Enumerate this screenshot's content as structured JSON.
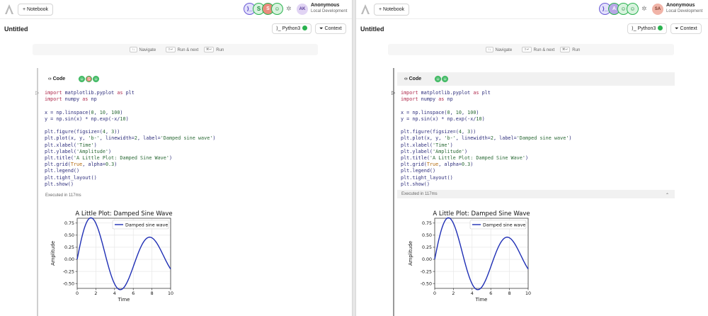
{
  "header": {
    "new_notebook_label": "+ Notebook",
    "user_name": "Anonymous",
    "user_sub": "Local Development"
  },
  "panes": [
    {
      "user_initials": "AK",
      "presence": [
        {
          "icon": "terminal-icon",
          "glyph": "⟩_"
        },
        {
          "icon": "avatar",
          "glyph": "S"
        },
        {
          "icon": "avatar",
          "glyph": "S"
        },
        {
          "icon": "bot-icon",
          "glyph": "☺"
        }
      ],
      "cell_avatars": [
        "☺",
        "S",
        "☺"
      ]
    },
    {
      "user_initials": "SA",
      "presence": [
        {
          "icon": "terminal-icon",
          "glyph": "⟩_"
        },
        {
          "icon": "avatar",
          "glyph": "A"
        },
        {
          "icon": "bot-icon",
          "glyph": "☺"
        },
        {
          "icon": "bot-icon",
          "glyph": "☺"
        }
      ],
      "cell_avatars": [
        "☺",
        "☺"
      ]
    }
  ],
  "notebook": {
    "title": "Untitled",
    "kernel_label": "Python3",
    "context_label": "Context"
  },
  "hints": {
    "navigate": {
      "key": "↑↓",
      "label": "Navigate"
    },
    "run_next": {
      "key": "⇧↵",
      "label": "Run & next"
    },
    "run": {
      "key": "⌘↵",
      "label": "Run"
    }
  },
  "cell": {
    "type_label": "Code",
    "executed_text": "Executed in 117ms"
  },
  "colors": {
    "presence_green": "#2ab24f",
    "line_color": "#1f2fb5"
  },
  "chart_data": {
    "type": "line",
    "title": "A Little Plot: Damped Sine Wave",
    "xlabel": "Time",
    "ylabel": "Amplitude",
    "xlim": [
      0,
      10
    ],
    "ylim": [
      -0.6,
      0.85
    ],
    "xticks": [
      "0",
      "2",
      "4",
      "6",
      "8",
      "10"
    ],
    "yticks": [
      "0.75",
      "0.50",
      "0.25",
      "0.00",
      "-0.25",
      "-0.50"
    ],
    "grid": true,
    "legend": "top-right",
    "series": [
      {
        "name": "Damped sine wave",
        "function": "sin(x)*exp(-x/10)",
        "x_start": 0,
        "x_end": 10,
        "points": 100
      }
    ]
  }
}
